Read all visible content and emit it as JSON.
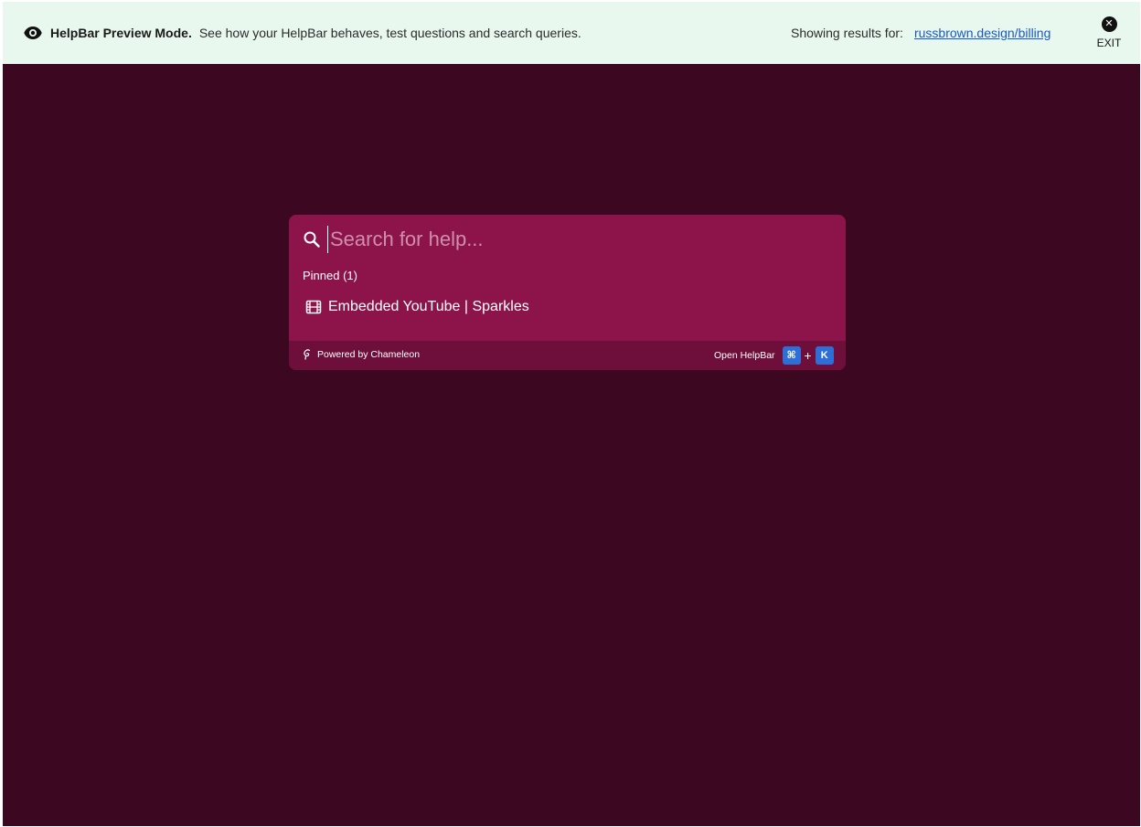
{
  "banner": {
    "title": "HelpBar Preview Mode.",
    "description": "See how your HelpBar behaves, test questions and search queries.",
    "results_label": "Showing results for:",
    "results_url": "russbrown.design/billing",
    "exit_label": "EXIT",
    "icons": {
      "preview": "eye-icon",
      "exit": "close-circle-icon"
    }
  },
  "helpbar": {
    "search_placeholder": "Search for help...",
    "search_value": "",
    "pinned_label": "Pinned (1)",
    "pinned_items": [
      {
        "label": "Embedded YouTube | Sparkles",
        "icon": "film-icon"
      }
    ],
    "footer": {
      "powered_by": "Powered by Chameleon",
      "open_label": "Open HelpBar",
      "shortcut": [
        "⌘",
        "+",
        "K"
      ]
    }
  },
  "colors": {
    "page_background": "#3c0720",
    "banner_background": "#e9f8ef",
    "helpbar_background": "#8c144a",
    "helpbar_footer": "#6d0f3a",
    "kbd_accent": "#2d6fd6",
    "link": "#1758c9"
  }
}
